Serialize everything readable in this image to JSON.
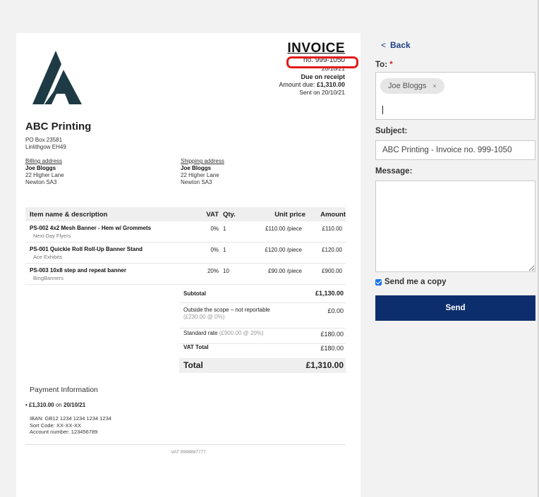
{
  "invoice": {
    "title": "INVOICE",
    "number": "no. 999-1050",
    "date": "20/10/21",
    "due": "Due on receipt",
    "amount_due_label": "Amount due:",
    "amount_due_value": "£1,310.00",
    "sent": "Sent on 20/10/21",
    "highlight_color": "#e01a1a"
  },
  "company": {
    "name": "ABC Printing",
    "address_line1": "PO Box 23581",
    "address_line2": "Linlithgow EH49"
  },
  "billing": {
    "label": "Billing address",
    "name": "Joe Bloggs",
    "line1": "22 Higher Lane",
    "line2": "Newton SA3"
  },
  "shipping": {
    "label": "Shipping address",
    "name": "Joe Bloggs",
    "line1": "22 Higher Lane",
    "line2": "Newton SA3"
  },
  "table": {
    "headers": {
      "item": "Item name & description",
      "vat": "VAT",
      "qty": "Qty.",
      "unit_price": "Unit price",
      "amount": "Amount"
    },
    "rows": [
      {
        "name": "PS-002 4x2 Mesh Banner - Hem w/ Grommets",
        "supplier": "Next Day Flyers",
        "vat": "0%",
        "qty": "1",
        "unit_price": "£110.00 /piece",
        "amount": "£110.00"
      },
      {
        "name": "PS-001 Quickie Roll Roll-Up Banner Stand",
        "supplier": "Ace Exhibits",
        "vat": "0%",
        "qty": "1",
        "unit_price": "£120.00 /piece",
        "amount": "£120.00"
      },
      {
        "name": "PS-003 10x8 step and repeat banner",
        "supplier": "BingBanners",
        "vat": "20%",
        "qty": "10",
        "unit_price": "£90.00 /piece",
        "amount": "£900.00"
      }
    ]
  },
  "totals": {
    "subtotal_label": "Subtotal",
    "subtotal_value": "£1,130.00",
    "outside_label": "Outside the scope – not reportable",
    "outside_detail": "(£230.00 @ 0%)",
    "outside_value": "£0.00",
    "standard_label": "Standard rate",
    "standard_detail": "(£900.00 @ 20%)",
    "standard_value": "£180.00",
    "vat_total_label": "VAT Total",
    "vat_total_value": "£180.00",
    "total_label": "Total",
    "total_value": "£1,310.00"
  },
  "payment": {
    "title": "Payment Information",
    "amount": "£1,310.00",
    "on_text": "on",
    "date": "20/10/21",
    "iban": "IBAN: GB12 1234 1234 1234 1234",
    "sort_code": "Sort Code: XX-XX-XX",
    "account_number": "Account number: 123456789"
  },
  "vat_number": "VAT 9998887777",
  "panel": {
    "back_label": "Back",
    "to_label": "To:",
    "required_marker": "*",
    "recipient_chip": "Joe Bloggs",
    "subject_label": "Subject:",
    "subject_value": "ABC Printing - Invoice no. 999-1050",
    "message_label": "Message:",
    "message_value": "",
    "send_copy_label": "Send me a copy",
    "send_copy_checked": true,
    "send_label": "Send",
    "send_color": "#0d2e6c",
    "link_color": "#1f3f82"
  }
}
